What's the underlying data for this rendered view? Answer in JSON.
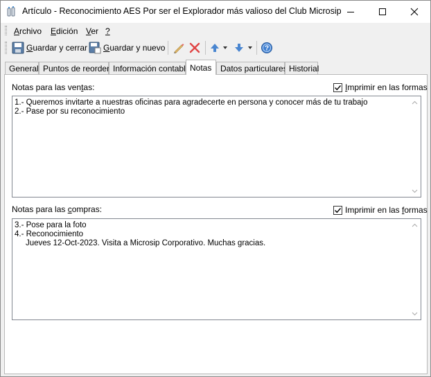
{
  "window": {
    "title": "Artículo - Reconocimiento AES Por ser el Explorador más valioso del Club Microsip"
  },
  "menu": {
    "archivo": {
      "underline": "A",
      "rest": "rchivo"
    },
    "edicion": {
      "underline": "E",
      "rest": "dición"
    },
    "ver": {
      "underline": "V",
      "rest": "er"
    },
    "ayuda": {
      "underline": "?",
      "rest": ""
    }
  },
  "toolbar": {
    "save_close": {
      "underline": "G",
      "rest": "uardar y cerrar"
    },
    "save_new": {
      "underline": "G",
      "rest": "uardar y nuevo"
    }
  },
  "tabs": [
    "General",
    "Puntos de reorden",
    "Información contable",
    "Notas",
    "Datos particulares",
    "Historial"
  ],
  "active_tab": "Notas",
  "sales_notes": {
    "label_before": "Notas para las ven",
    "label_underline": "t",
    "label_after": "as:",
    "print_before": "",
    "print_underline": "I",
    "print_after": "mprimir en las formas",
    "print_checked": true,
    "text": "1.- Queremos invitarte a nuestras oficinas para agradecerte en persona y conocer más de tu trabajo\n2.- Pase por su reconocimiento"
  },
  "purchase_notes": {
    "label_before": "Notas para las ",
    "label_underline": "c",
    "label_after": "ompras:",
    "print_before": "Imprimir en las ",
    "print_underline": "f",
    "print_after": "ormas",
    "print_checked": true,
    "text": "3.- Pose para la foto\n4.- Reconocimiento\n     Jueves 12-Oct-2023. Visita a Microsip Corporativo. Muchas gracias."
  }
}
